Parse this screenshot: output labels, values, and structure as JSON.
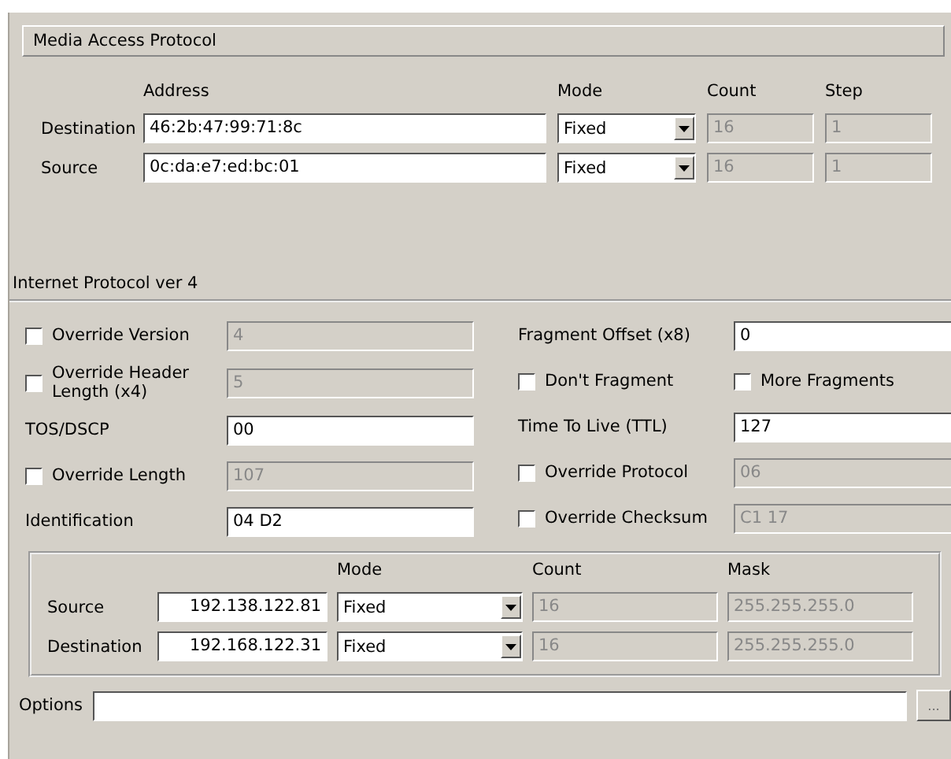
{
  "mac": {
    "title": "Media Access Protocol",
    "columns": [
      "Address",
      "Mode",
      "Count",
      "Step"
    ],
    "rows": [
      {
        "label": "Destination",
        "address": "46:2b:47:99:71:8c",
        "mode": "Fixed",
        "count": {
          "value": "16",
          "disabled": true
        },
        "step": {
          "value": "1",
          "disabled": true
        }
      },
      {
        "label": "Source",
        "address": "0c:da:e7:ed:bc:01",
        "mode": "Fixed",
        "count": {
          "value": "16",
          "disabled": true
        },
        "step": {
          "value": "1",
          "disabled": true
        }
      }
    ]
  },
  "ip": {
    "title": "Internet Protocol ver 4",
    "left": [
      {
        "kind": "checkbox",
        "label": "Override Version",
        "checked": false,
        "value": "4",
        "disabled": true
      },
      {
        "kind": "checkbox",
        "label": "Override Header Length (x4)",
        "checked": false,
        "value": "5",
        "disabled": true
      },
      {
        "kind": "plain",
        "label": "TOS/DSCP",
        "value": "00",
        "disabled": false
      },
      {
        "kind": "checkbox",
        "label": "Override Length",
        "checked": false,
        "value": "107",
        "disabled": true
      },
      {
        "kind": "plain",
        "label": "Identification",
        "value": "04 D2",
        "disabled": false
      }
    ],
    "right": [
      {
        "kind": "plain",
        "label": "Fragment Offset (x8)",
        "value": "0",
        "disabled": false
      },
      {
        "kind": "flags",
        "flags": [
          {
            "label": "Don't Fragment",
            "checked": false
          },
          {
            "label": "More Fragments",
            "checked": false
          }
        ]
      },
      {
        "kind": "plain",
        "label": "Time To Live (TTL)",
        "value": "127",
        "disabled": false
      },
      {
        "kind": "checkbox",
        "label": "Override Protocol",
        "checked": false,
        "value": "06",
        "disabled": true
      },
      {
        "kind": "checkbox",
        "label": "Override Checksum",
        "checked": false,
        "value": "C1 17",
        "disabled": true
      }
    ]
  },
  "addresses": {
    "columns": [
      "Mode",
      "Count",
      "Mask"
    ],
    "rows": [
      {
        "label": "Source",
        "address": "192.138.122.81",
        "mode": "Fixed",
        "count": {
          "value": "16",
          "disabled": true
        },
        "mask": {
          "value": "255.255.255.0",
          "disabled": true
        }
      },
      {
        "label": "Destination",
        "address": "192.168.122.31",
        "mode": "Fixed",
        "count": {
          "value": "16",
          "disabled": true
        },
        "mask": {
          "value": "255.255.255.0",
          "disabled": true
        }
      }
    ]
  },
  "options": {
    "label": "Options",
    "button": "..."
  }
}
